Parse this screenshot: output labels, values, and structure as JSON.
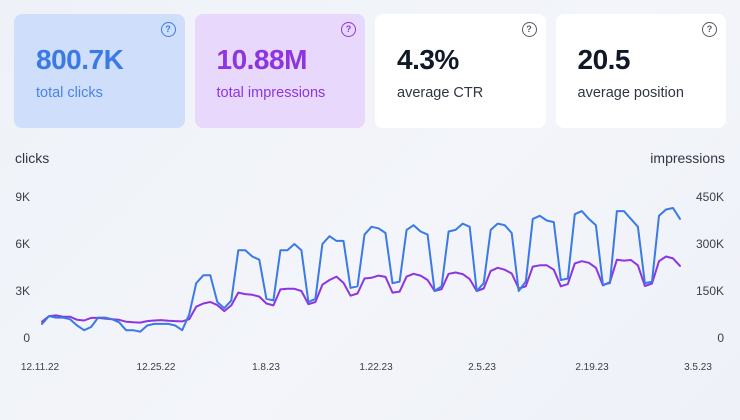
{
  "cards": [
    {
      "value": "800.7K",
      "label": "total clicks",
      "help": "?"
    },
    {
      "value": "10.88M",
      "label": "total impressions",
      "help": "?"
    },
    {
      "value": "4.3%",
      "label": "average CTR",
      "help": "?"
    },
    {
      "value": "20.5",
      "label": "average position",
      "help": "?"
    }
  ],
  "colors": {
    "clicks": "#3b7ae6",
    "impressions": "#8e35e0",
    "clicks_card_bg": "#cfdffb",
    "impressions_card_bg": "#e8d8fb"
  },
  "chart_data": {
    "type": "line",
    "xlabel": "",
    "ylabel": "clicks",
    "y2label": "impressions",
    "ylim": [
      0,
      9000
    ],
    "y2lim": [
      0,
      450000
    ],
    "yticks": [
      "0",
      "3K",
      "6K",
      "9K"
    ],
    "y2ticks": [
      "0",
      "150K",
      "300K",
      "450K"
    ],
    "x_tick_labels": [
      "12.11.22",
      "12.25.22",
      "1.8.23",
      "1.22.23",
      "2.5.23",
      "2.19.23",
      "3.5.23"
    ],
    "x_start": "2022-12-11",
    "x_end": "2023-03-05",
    "grid": false,
    "series": [
      {
        "name": "clicks",
        "axis": "left",
        "values": [
          900,
          1400,
          1300,
          1300,
          1200,
          800,
          500,
          700,
          1300,
          1300,
          1200,
          1000,
          500,
          500,
          400,
          800,
          900,
          900,
          900,
          800,
          500,
          1500,
          3500,
          4000,
          4000,
          2300,
          1900,
          2400,
          5600,
          5600,
          5200,
          5000,
          2500,
          2400,
          5600,
          5600,
          6000,
          5600,
          2300,
          2500,
          6000,
          6500,
          6200,
          6200,
          3200,
          3300,
          6600,
          7100,
          7000,
          6700,
          3500,
          3600,
          6900,
          7200,
          6800,
          6600,
          3000,
          3300,
          6800,
          6900,
          7300,
          7100,
          3000,
          3500,
          6900,
          7300,
          7200,
          6700,
          3000,
          3600,
          7600,
          7800,
          7500,
          7400,
          3700,
          3800,
          7900,
          8100,
          7600,
          7200,
          3400,
          3500,
          8100,
          8100,
          7600,
          7100,
          3500,
          3600,
          7800,
          8200,
          8300,
          7600
        ]
      },
      {
        "name": "impressions",
        "axis": "right",
        "values": [
          52000,
          70000,
          72000,
          68000,
          68000,
          58000,
          56000,
          64000,
          64000,
          62000,
          60000,
          58000,
          52000,
          50000,
          49000,
          54000,
          56000,
          57000,
          55000,
          54000,
          53000,
          60000,
          100000,
          110000,
          115000,
          105000,
          86000,
          104000,
          145000,
          140000,
          138000,
          132000,
          110000,
          104000,
          155000,
          157000,
          157000,
          150000,
          108000,
          115000,
          170000,
          185000,
          196000,
          176000,
          135000,
          142000,
          190000,
          192000,
          199000,
          195000,
          145000,
          148000,
          196000,
          205000,
          199000,
          185000,
          150000,
          156000,
          205000,
          209000,
          204000,
          188000,
          150000,
          158000,
          214000,
          224000,
          218000,
          206000,
          158000,
          165000,
          228000,
          232000,
          232000,
          218000,
          165000,
          172000,
          238000,
          245000,
          240000,
          224000,
          168000,
          178000,
          250000,
          247000,
          249000,
          232000,
          166000,
          174000,
          245000,
          260000,
          254000,
          230000
        ]
      }
    ]
  }
}
